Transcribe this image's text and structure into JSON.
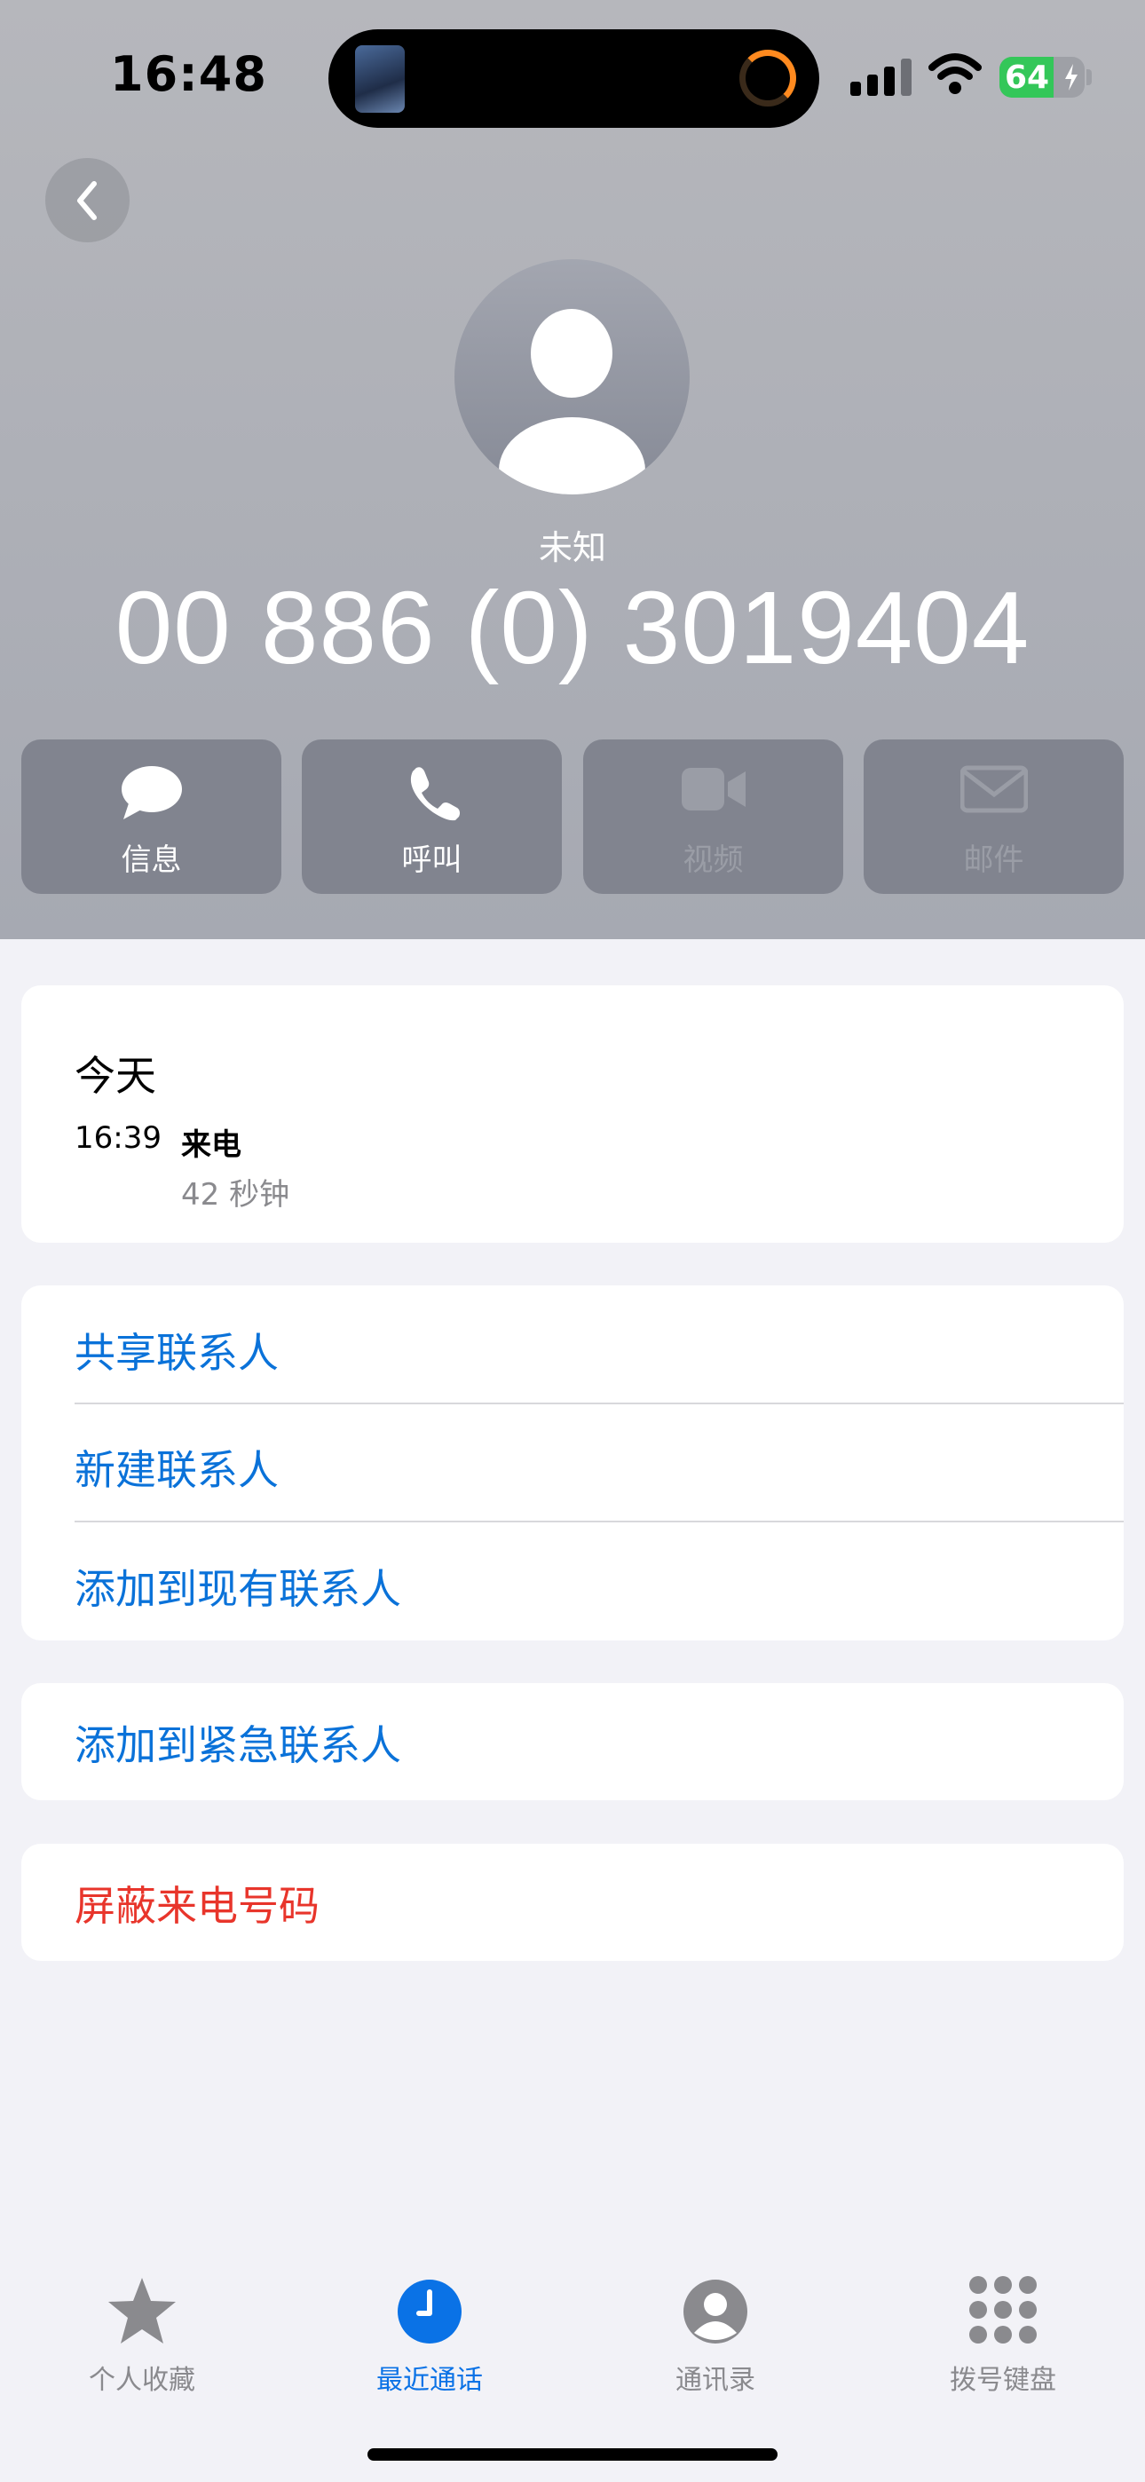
{
  "status_bar": {
    "time": "16:48",
    "battery_percent": 64,
    "battery_label": "64",
    "charging": true
  },
  "contact": {
    "label": "未知",
    "number": "00 886 (0) 3019404"
  },
  "actions": [
    {
      "label": "信息",
      "icon": "message-bubble-icon",
      "enabled": true
    },
    {
      "label": "呼叫",
      "icon": "phone-icon",
      "enabled": true
    },
    {
      "label": "视频",
      "icon": "video-camera-icon",
      "enabled": false
    },
    {
      "label": "邮件",
      "icon": "envelope-icon",
      "enabled": false
    }
  ],
  "recent_call": {
    "day": "今天",
    "time": "16:39",
    "type": "来电",
    "duration": "42 秒钟"
  },
  "options": {
    "share_contact": "共享联系人",
    "new_contact": "新建联系人",
    "add_to_existing": "添加到现有联系人",
    "add_to_emergency": "添加到紧急联系人",
    "block_caller": "屏蔽来电号码"
  },
  "tabs": [
    {
      "label": "个人收藏",
      "icon": "star-icon",
      "active": false
    },
    {
      "label": "最近通话",
      "icon": "clock-icon",
      "active": true
    },
    {
      "label": "通讯录",
      "icon": "person-circle-icon",
      "active": false
    },
    {
      "label": "拨号键盘",
      "icon": "keypad-icon",
      "active": false
    }
  ],
  "colors": {
    "accent": "#0a72e6",
    "link": "#0a72d9",
    "danger": "#e8352b",
    "battery": "#34c759"
  }
}
